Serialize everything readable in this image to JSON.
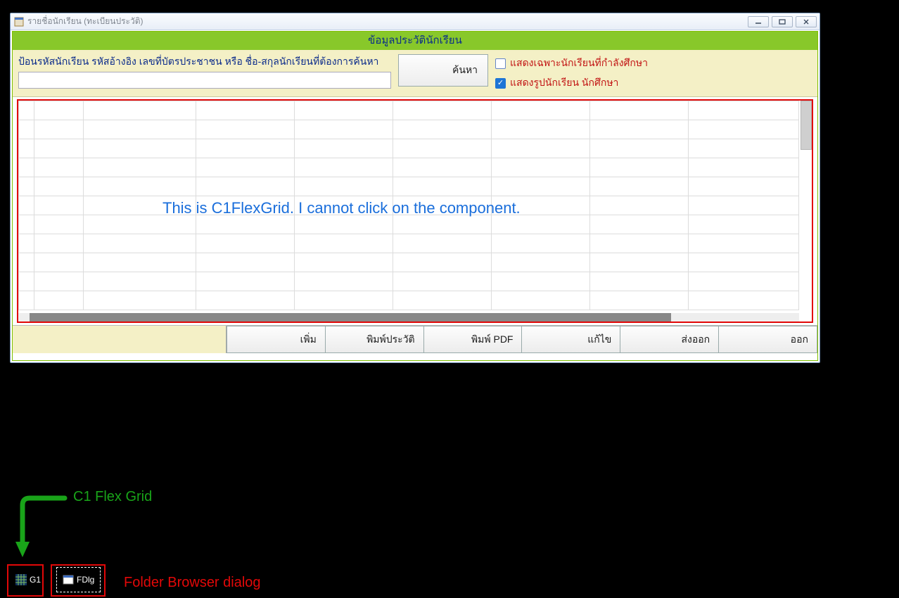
{
  "window": {
    "title": "รายชื่อนักเรียน (ทะเบียนประวัติ)"
  },
  "header": {
    "title": "ข้อมูลประวัตินักเรียน"
  },
  "search": {
    "label": "ป้อนรหัสนักเรียน รหัสอ้างอิง เลขที่บัตรประชาชน หรือ ชื่อ-สกุลนักเรียนที่ต้องการค้นหา",
    "value": "",
    "button": "ค้นหา"
  },
  "options": {
    "show_current_students": "แสดงเฉพาะนักเรียนที่กำลังศึกษา",
    "show_photos": "แสดงรูปนักเรียน นักศึกษา"
  },
  "grid_annotation": "This is C1FlexGrid. I cannot click on the component.",
  "footer": {
    "add": "เพิ่ม",
    "print_profile": "พิมพ์ประวัติ",
    "print_pdf": "พิมพ์ PDF",
    "edit": "แก้ไข",
    "export": "ส่งออก",
    "exit": "ออก"
  },
  "designer": {
    "g1": "G1",
    "fdlg": "FDlg"
  },
  "annotations": {
    "flexgrid_label": "C1 Flex Grid",
    "folder_label": "Folder Browser dialog"
  }
}
